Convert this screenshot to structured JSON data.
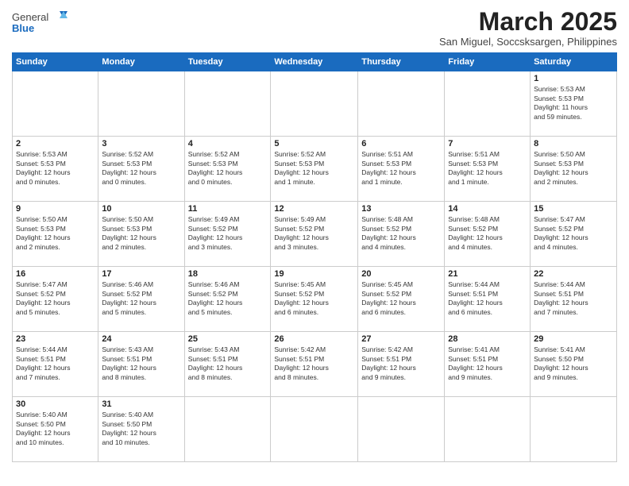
{
  "logo": {
    "text_general": "General",
    "text_blue": "Blue"
  },
  "header": {
    "month_title": "March 2025",
    "subtitle": "San Miguel, Soccsksargen, Philippines"
  },
  "weekdays": [
    "Sunday",
    "Monday",
    "Tuesday",
    "Wednesday",
    "Thursday",
    "Friday",
    "Saturday"
  ],
  "days": {
    "d1": {
      "num": "1",
      "info": "Sunrise: 5:53 AM\nSunset: 5:53 PM\nDaylight: 11 hours\nand 59 minutes."
    },
    "d2": {
      "num": "2",
      "info": "Sunrise: 5:53 AM\nSunset: 5:53 PM\nDaylight: 12 hours\nand 0 minutes."
    },
    "d3": {
      "num": "3",
      "info": "Sunrise: 5:52 AM\nSunset: 5:53 PM\nDaylight: 12 hours\nand 0 minutes."
    },
    "d4": {
      "num": "4",
      "info": "Sunrise: 5:52 AM\nSunset: 5:53 PM\nDaylight: 12 hours\nand 0 minutes."
    },
    "d5": {
      "num": "5",
      "info": "Sunrise: 5:52 AM\nSunset: 5:53 PM\nDaylight: 12 hours\nand 1 minute."
    },
    "d6": {
      "num": "6",
      "info": "Sunrise: 5:51 AM\nSunset: 5:53 PM\nDaylight: 12 hours\nand 1 minute."
    },
    "d7": {
      "num": "7",
      "info": "Sunrise: 5:51 AM\nSunset: 5:53 PM\nDaylight: 12 hours\nand 1 minute."
    },
    "d8": {
      "num": "8",
      "info": "Sunrise: 5:50 AM\nSunset: 5:53 PM\nDaylight: 12 hours\nand 2 minutes."
    },
    "d9": {
      "num": "9",
      "info": "Sunrise: 5:50 AM\nSunset: 5:53 PM\nDaylight: 12 hours\nand 2 minutes."
    },
    "d10": {
      "num": "10",
      "info": "Sunrise: 5:50 AM\nSunset: 5:53 PM\nDaylight: 12 hours\nand 2 minutes."
    },
    "d11": {
      "num": "11",
      "info": "Sunrise: 5:49 AM\nSunset: 5:52 PM\nDaylight: 12 hours\nand 3 minutes."
    },
    "d12": {
      "num": "12",
      "info": "Sunrise: 5:49 AM\nSunset: 5:52 PM\nDaylight: 12 hours\nand 3 minutes."
    },
    "d13": {
      "num": "13",
      "info": "Sunrise: 5:48 AM\nSunset: 5:52 PM\nDaylight: 12 hours\nand 4 minutes."
    },
    "d14": {
      "num": "14",
      "info": "Sunrise: 5:48 AM\nSunset: 5:52 PM\nDaylight: 12 hours\nand 4 minutes."
    },
    "d15": {
      "num": "15",
      "info": "Sunrise: 5:47 AM\nSunset: 5:52 PM\nDaylight: 12 hours\nand 4 minutes."
    },
    "d16": {
      "num": "16",
      "info": "Sunrise: 5:47 AM\nSunset: 5:52 PM\nDaylight: 12 hours\nand 5 minutes."
    },
    "d17": {
      "num": "17",
      "info": "Sunrise: 5:46 AM\nSunset: 5:52 PM\nDaylight: 12 hours\nand 5 minutes."
    },
    "d18": {
      "num": "18",
      "info": "Sunrise: 5:46 AM\nSunset: 5:52 PM\nDaylight: 12 hours\nand 5 minutes."
    },
    "d19": {
      "num": "19",
      "info": "Sunrise: 5:45 AM\nSunset: 5:52 PM\nDaylight: 12 hours\nand 6 minutes."
    },
    "d20": {
      "num": "20",
      "info": "Sunrise: 5:45 AM\nSunset: 5:52 PM\nDaylight: 12 hours\nand 6 minutes."
    },
    "d21": {
      "num": "21",
      "info": "Sunrise: 5:44 AM\nSunset: 5:51 PM\nDaylight: 12 hours\nand 6 minutes."
    },
    "d22": {
      "num": "22",
      "info": "Sunrise: 5:44 AM\nSunset: 5:51 PM\nDaylight: 12 hours\nand 7 minutes."
    },
    "d23": {
      "num": "23",
      "info": "Sunrise: 5:44 AM\nSunset: 5:51 PM\nDaylight: 12 hours\nand 7 minutes."
    },
    "d24": {
      "num": "24",
      "info": "Sunrise: 5:43 AM\nSunset: 5:51 PM\nDaylight: 12 hours\nand 8 minutes."
    },
    "d25": {
      "num": "25",
      "info": "Sunrise: 5:43 AM\nSunset: 5:51 PM\nDaylight: 12 hours\nand 8 minutes."
    },
    "d26": {
      "num": "26",
      "info": "Sunrise: 5:42 AM\nSunset: 5:51 PM\nDaylight: 12 hours\nand 8 minutes."
    },
    "d27": {
      "num": "27",
      "info": "Sunrise: 5:42 AM\nSunset: 5:51 PM\nDaylight: 12 hours\nand 9 minutes."
    },
    "d28": {
      "num": "28",
      "info": "Sunrise: 5:41 AM\nSunset: 5:51 PM\nDaylight: 12 hours\nand 9 minutes."
    },
    "d29": {
      "num": "29",
      "info": "Sunrise: 5:41 AM\nSunset: 5:50 PM\nDaylight: 12 hours\nand 9 minutes."
    },
    "d30": {
      "num": "30",
      "info": "Sunrise: 5:40 AM\nSunset: 5:50 PM\nDaylight: 12 hours\nand 10 minutes."
    },
    "d31": {
      "num": "31",
      "info": "Sunrise: 5:40 AM\nSunset: 5:50 PM\nDaylight: 12 hours\nand 10 minutes."
    }
  }
}
